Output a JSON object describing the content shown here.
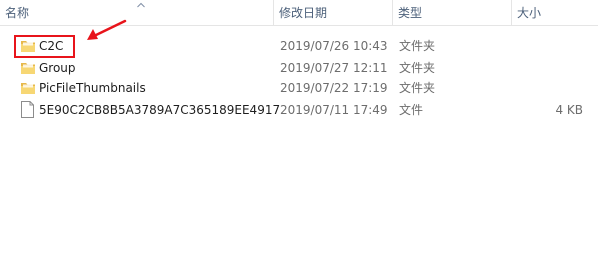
{
  "columns": {
    "name": "名称",
    "date": "修改日期",
    "type": "类型",
    "size": "大小"
  },
  "files": [
    {
      "name": "C2C",
      "date": "2019/07/26 10:43",
      "type": "文件夹",
      "size": "",
      "icon": "folder-icon"
    },
    {
      "name": "Group",
      "date": "2019/07/27 12:11",
      "type": "文件夹",
      "size": "",
      "icon": "folder-icon"
    },
    {
      "name": "PicFileThumbnails",
      "date": "2019/07/22 17:19",
      "type": "文件夹",
      "size": "",
      "icon": "folder-icon"
    },
    {
      "name": "5E90C2CB8B5A3789A7C365189EE4917",
      "date": "2019/07/11 17:49",
      "type": "文件",
      "size": "4 KB",
      "icon": "file-icon"
    }
  ],
  "sort": {
    "column": "name",
    "indicator": "chevron-up-icon"
  },
  "annotation": {
    "color": "#e8141b",
    "target": "C2C"
  }
}
